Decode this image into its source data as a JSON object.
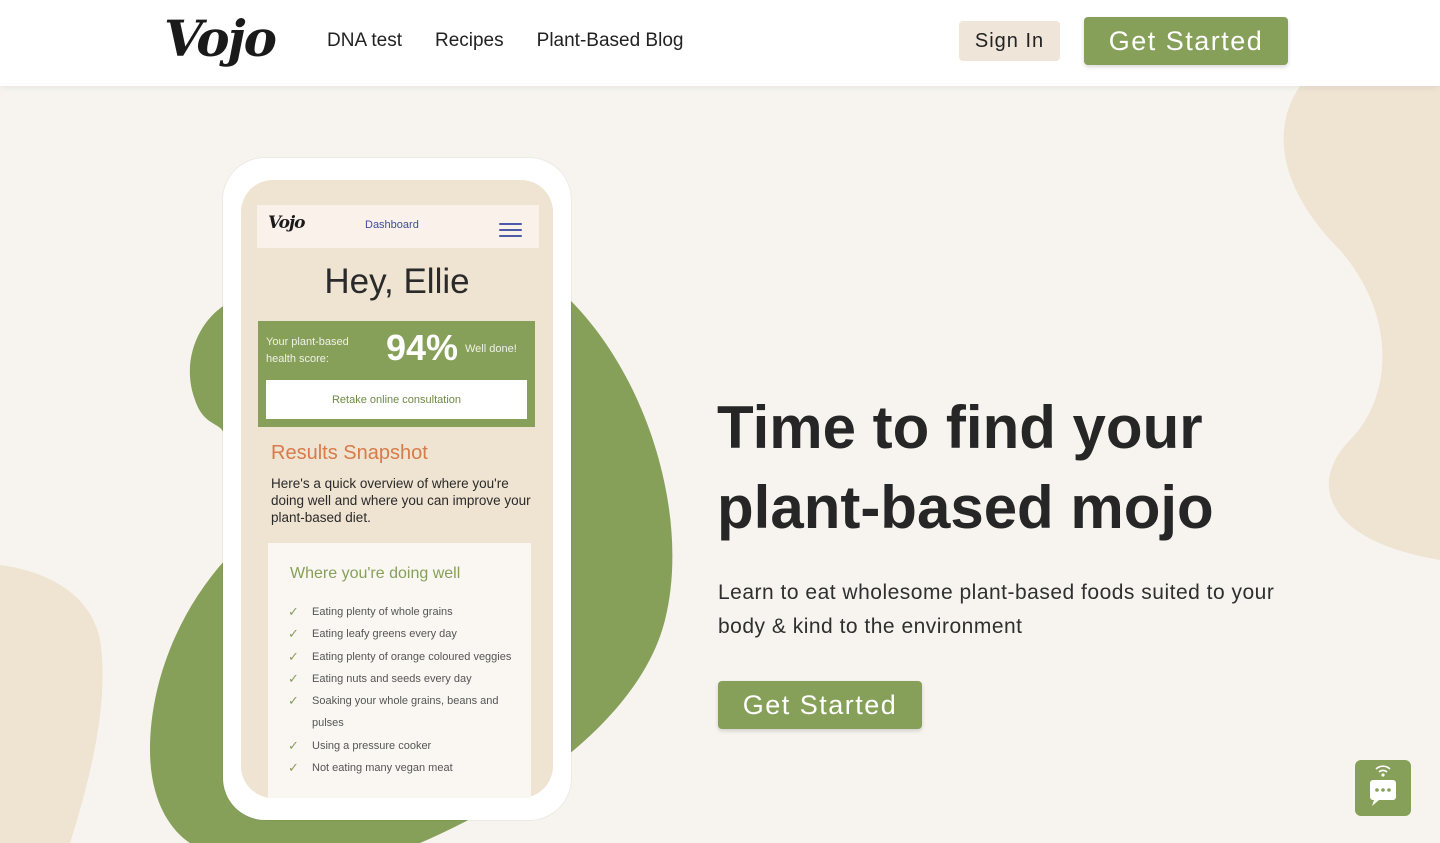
{
  "header": {
    "logo": "Vojo",
    "nav": [
      "DNA test",
      "Recipes",
      "Plant-Based Blog"
    ],
    "sign_in": "Sign In",
    "get_started": "Get Started"
  },
  "phone": {
    "app_logo": "Vojo",
    "app_title": "Dashboard",
    "greeting": "Hey, Ellie",
    "score_label": "Your plant-based health score:",
    "score_value": "94%",
    "score_note": "Well done!",
    "retake": "Retake online consultation",
    "snapshot_title": "Results Snapshot",
    "snapshot_desc": "Here's a quick overview of where you're doing well and where you can improve your plant-based diet.",
    "well_title": "Where you're doing well",
    "well_items": [
      "Eating plenty of whole grains",
      "Eating leafy greens every day",
      "Eating plenty of orange coloured veggies",
      "Eating nuts and seeds every day",
      "Soaking your whole grains, beans and pulses",
      "Using a pressure cooker",
      "Not eating many vegan meat"
    ]
  },
  "hero": {
    "title_line1": "Time to find your",
    "title_line2": "plant-based mojo",
    "subtitle": "Learn to eat wholesome plant-based foods suited to your body & kind to the environment",
    "cta": "Get Started"
  },
  "colors": {
    "brand_green": "#86a05a",
    "beige": "#efe3d2",
    "background": "#f7f4ef",
    "accent_orange": "#d77b4a"
  },
  "icons": {
    "check": "check-icon",
    "menu": "hamburger-icon",
    "chat": "chat-icon"
  }
}
